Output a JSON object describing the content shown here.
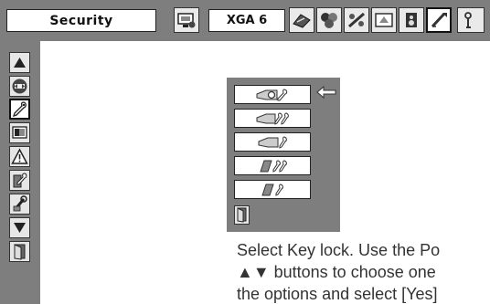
{
  "topbar": {
    "title": "Security",
    "value": "XGA 6",
    "icons": [
      "pc-adjust-icon",
      "image-select-icon",
      "image-adjust-icon",
      "screen-icon",
      "keystone-icon",
      "sound-icon",
      "setting-icon",
      "info-icon"
    ]
  },
  "sidebar": {
    "icons": [
      "scroll-up-icon",
      "auto-icon",
      "key-lock-icon",
      "monitor-icon",
      "warning-icon",
      "pin-code-icon",
      "tools-icon",
      "scroll-down-icon",
      "exit-icon"
    ]
  },
  "submenu": {
    "items": [
      "key-lock-off-icon",
      "key-lock-projector-icon",
      "key-lock-remote-icon",
      "pin-lock-icon",
      "pin-change-icon"
    ],
    "exit_icon": "exit-icon",
    "pointer": "pointer-arrow-icon"
  },
  "instructions": {
    "line1": "Select Key lock. Use the Po",
    "line2": "▲▼ buttons to choose one",
    "line3": "the options and select [Yes]"
  },
  "colors": {
    "menu_gray": "#7e7e7e",
    "box_white": "#ffffff",
    "text": "#333333"
  }
}
